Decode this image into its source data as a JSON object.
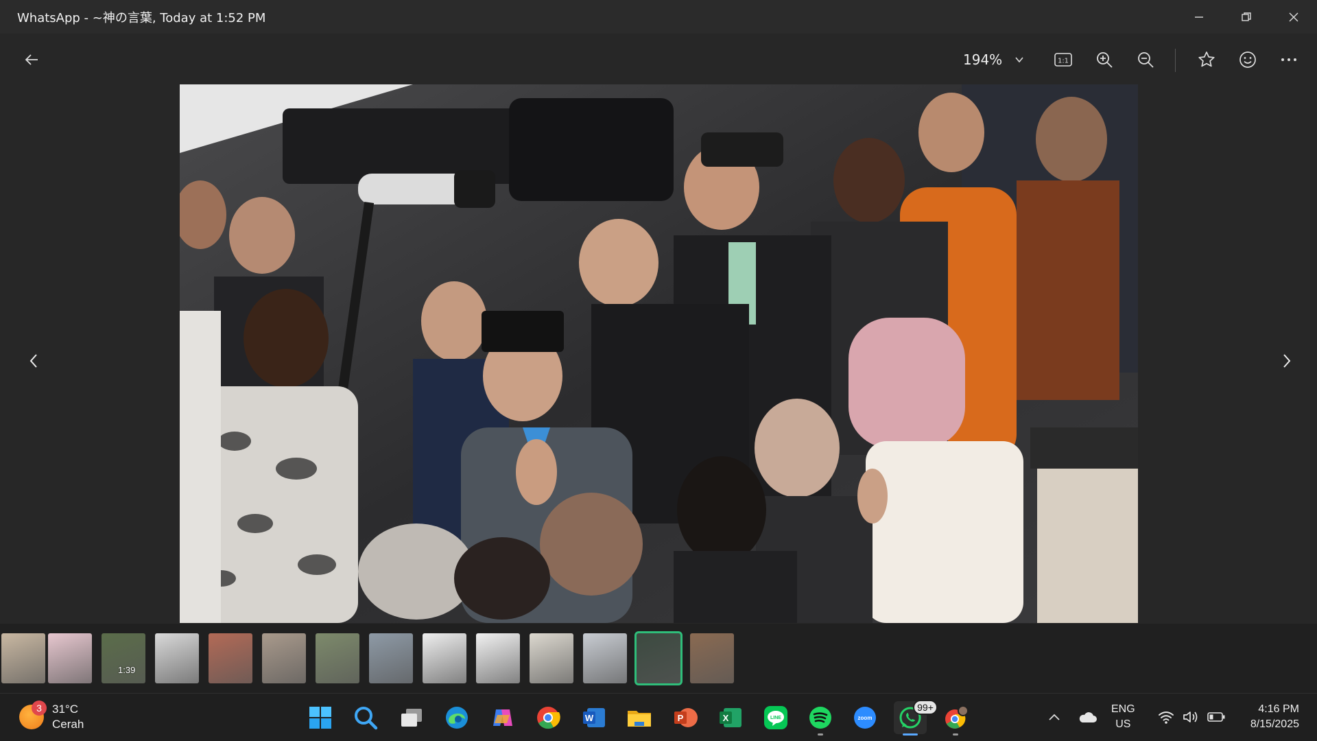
{
  "window": {
    "title": "WhatsApp - ~神の言葉, Today at 1:52 PM"
  },
  "toolbar": {
    "zoom_level": "194%"
  },
  "filmstrip": {
    "video_duration": "1:39",
    "thumb_colors": [
      "#c9b8a2",
      "#e7c7cf",
      "#5b6d4a",
      "#d9d9d9",
      "#b36a56",
      "#a99a8c",
      "#7d8a6b",
      "#8e9aa6",
      "#eeeeee",
      "#f1f1f1",
      "#dcd8cf",
      "#c8ccd2",
      "#3c4a40",
      "#8a6a52"
    ]
  },
  "taskbar": {
    "weather_badge": "3",
    "temperature": "31°C",
    "condition": "Cerah",
    "whatsapp_badge": "99+",
    "lang_line1": "ENG",
    "lang_line2": "US",
    "time": "4:16 PM",
    "date": "8/15/2025"
  },
  "colors": {
    "accent": "#2fbe7a",
    "taskbar_indicator": "#5aa9ff"
  }
}
